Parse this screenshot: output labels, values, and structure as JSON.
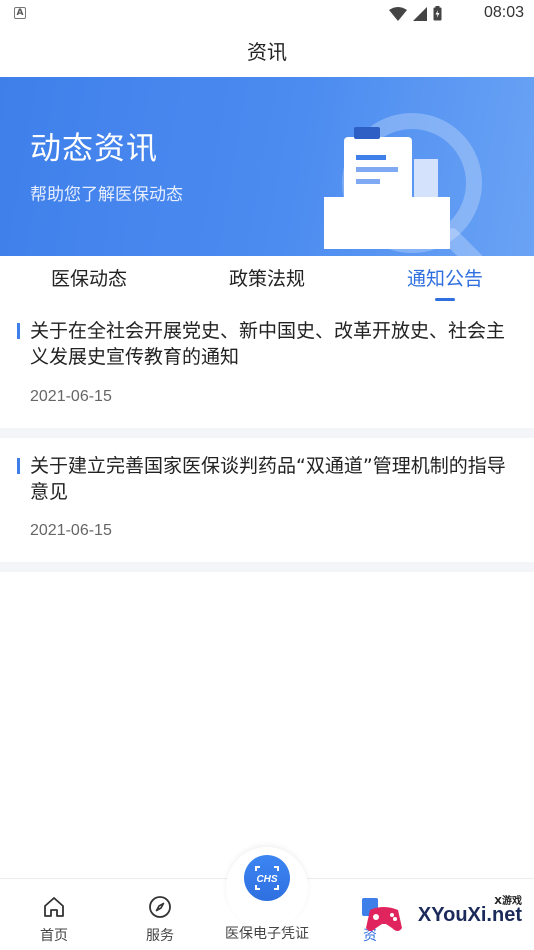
{
  "status_bar": {
    "time": "08:03",
    "notification_badge": "A"
  },
  "header": {
    "title": "资讯"
  },
  "banner": {
    "title": "动态资讯",
    "subtitle": "帮助您了解医保动态",
    "color_start": "#3f7fea",
    "color_end": "#6aa3f5"
  },
  "tabs": [
    {
      "label": "医保动态",
      "active": false
    },
    {
      "label": "政策法规",
      "active": false
    },
    {
      "label": "通知公告",
      "active": true
    }
  ],
  "news": [
    {
      "title": "关于在全社会开展党史、新中国史、改革开放史、社会主义发展史宣传教育的通知",
      "date": "2021-06-15"
    },
    {
      "title": "关于建立完善国家医保谈判药品“双通道”管理机制的指导意见",
      "date": "2021-06-15"
    }
  ],
  "bottom_nav": {
    "items": [
      {
        "label": "首页",
        "icon": "home-icon"
      },
      {
        "label": "服务",
        "icon": "compass-icon"
      },
      {
        "label": "医保电子凭证",
        "icon": "chs-icon",
        "badge_text": "CHS"
      },
      {
        "label": "资",
        "icon": "news-icon"
      }
    ]
  },
  "watermark": {
    "small_text": "X游戏",
    "big_text": "XYouXi.net"
  },
  "accent_color": "#2f6fe0"
}
